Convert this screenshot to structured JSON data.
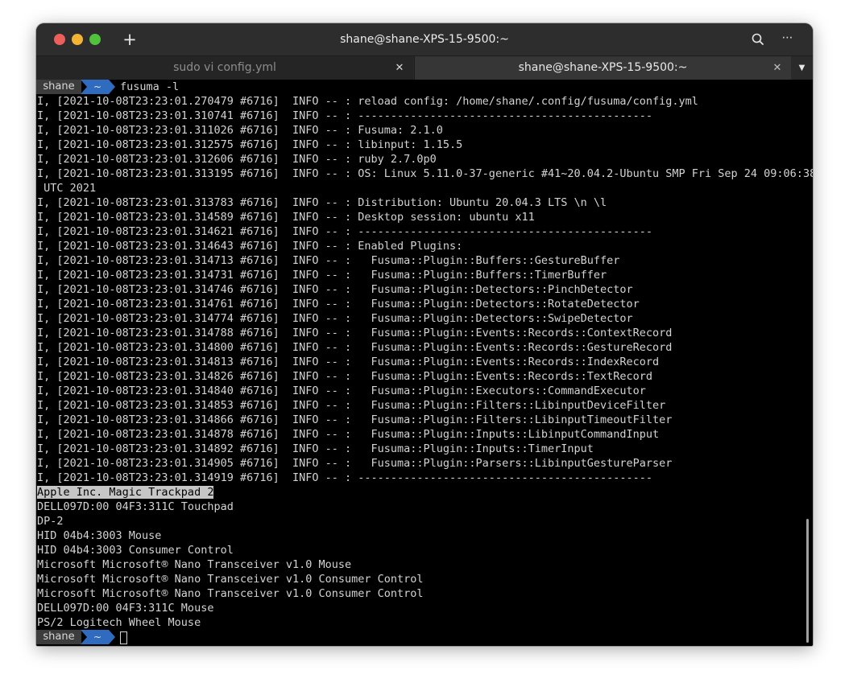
{
  "window": {
    "title": "shane@shane-XPS-15-9500:~",
    "new_tab_symbol": "+",
    "menu_symbol": "⋯",
    "search_icon": "magnifier"
  },
  "tabs": [
    {
      "label": "sudo vi config.yml",
      "close": "✕",
      "active": false
    },
    {
      "label": "shane@shane-XPS-15-9500:~",
      "close": "✕",
      "active": true
    }
  ],
  "tab_dropdown": "▼",
  "prompt": {
    "user": "shane",
    "dir": "~",
    "command": "fusuma -l",
    "colors": {
      "user_bg": "#3c3c3c",
      "dir_bg": "#2f6bbf"
    }
  },
  "lines": [
    {
      "text": "I, [2021-10-08T23:23:01.270479 #6716]  INFO -- : reload config: /home/shane/.config/fusuma/config.yml"
    },
    {
      "text": "I, [2021-10-08T23:23:01.310741 #6716]  INFO -- : ---------------------------------------------"
    },
    {
      "text": "I, [2021-10-08T23:23:01.311026 #6716]  INFO -- : Fusuma: 2.1.0"
    },
    {
      "text": "I, [2021-10-08T23:23:01.312575 #6716]  INFO -- : libinput: 1.15.5"
    },
    {
      "text": "I, [2021-10-08T23:23:01.312606 #6716]  INFO -- : ruby 2.7.0p0"
    },
    {
      "text": "I, [2021-10-08T23:23:01.313195 #6716]  INFO -- : OS: Linux 5.11.0-37-generic #41~20.04.2-Ubuntu SMP Fri Sep 24 09:06:38"
    },
    {
      "text": " UTC 2021"
    },
    {
      "text": "I, [2021-10-08T23:23:01.313783 #6716]  INFO -- : Distribution: Ubuntu 20.04.3 LTS \\n \\l"
    },
    {
      "text": "I, [2021-10-08T23:23:01.314589 #6716]  INFO -- : Desktop session: ubuntu x11"
    },
    {
      "text": "I, [2021-10-08T23:23:01.314621 #6716]  INFO -- : ---------------------------------------------"
    },
    {
      "text": "I, [2021-10-08T23:23:01.314643 #6716]  INFO -- : Enabled Plugins:"
    },
    {
      "text": "I, [2021-10-08T23:23:01.314713 #6716]  INFO -- :   Fusuma::Plugin::Buffers::GestureBuffer"
    },
    {
      "text": "I, [2021-10-08T23:23:01.314731 #6716]  INFO -- :   Fusuma::Plugin::Buffers::TimerBuffer"
    },
    {
      "text": "I, [2021-10-08T23:23:01.314746 #6716]  INFO -- :   Fusuma::Plugin::Detectors::PinchDetector"
    },
    {
      "text": "I, [2021-10-08T23:23:01.314761 #6716]  INFO -- :   Fusuma::Plugin::Detectors::RotateDetector"
    },
    {
      "text": "I, [2021-10-08T23:23:01.314774 #6716]  INFO -- :   Fusuma::Plugin::Detectors::SwipeDetector"
    },
    {
      "text": "I, [2021-10-08T23:23:01.314788 #6716]  INFO -- :   Fusuma::Plugin::Events::Records::ContextRecord"
    },
    {
      "text": "I, [2021-10-08T23:23:01.314800 #6716]  INFO -- :   Fusuma::Plugin::Events::Records::GestureRecord"
    },
    {
      "text": "I, [2021-10-08T23:23:01.314813 #6716]  INFO -- :   Fusuma::Plugin::Events::Records::IndexRecord"
    },
    {
      "text": "I, [2021-10-08T23:23:01.314826 #6716]  INFO -- :   Fusuma::Plugin::Events::Records::TextRecord"
    },
    {
      "text": "I, [2021-10-08T23:23:01.314840 #6716]  INFO -- :   Fusuma::Plugin::Executors::CommandExecutor"
    },
    {
      "text": "I, [2021-10-08T23:23:01.314853 #6716]  INFO -- :   Fusuma::Plugin::Filters::LibinputDeviceFilter"
    },
    {
      "text": "I, [2021-10-08T23:23:01.314866 #6716]  INFO -- :   Fusuma::Plugin::Filters::LibinputTimeoutFilter"
    },
    {
      "text": "I, [2021-10-08T23:23:01.314878 #6716]  INFO -- :   Fusuma::Plugin::Inputs::LibinputCommandInput"
    },
    {
      "text": "I, [2021-10-08T23:23:01.314892 #6716]  INFO -- :   Fusuma::Plugin::Inputs::TimerInput"
    },
    {
      "text": "I, [2021-10-08T23:23:01.314905 #6716]  INFO -- :   Fusuma::Plugin::Parsers::LibinputGestureParser"
    },
    {
      "text": "I, [2021-10-08T23:23:01.314919 #6716]  INFO -- : ---------------------------------------------"
    },
    {
      "text": "Apple Inc. Magic Trackpad 2",
      "highlighted": true
    },
    {
      "text": "DELL097D:00 04F3:311C Touchpad"
    },
    {
      "text": "DP-2"
    },
    {
      "text": "HID 04b4:3003 Mouse"
    },
    {
      "text": "HID 04b4:3003 Consumer Control"
    },
    {
      "text": "Microsoft Microsoft® Nano Transceiver v1.0 Mouse"
    },
    {
      "text": "Microsoft Microsoft® Nano Transceiver v1.0 Consumer Control"
    },
    {
      "text": "Microsoft Microsoft® Nano Transceiver v1.0 Consumer Control"
    },
    {
      "text": "DELL097D:00 04F3:311C Mouse"
    },
    {
      "text": "PS/2 Logitech Wheel Mouse"
    }
  ],
  "final_prompt": {
    "user": "shane",
    "dir": "~"
  }
}
